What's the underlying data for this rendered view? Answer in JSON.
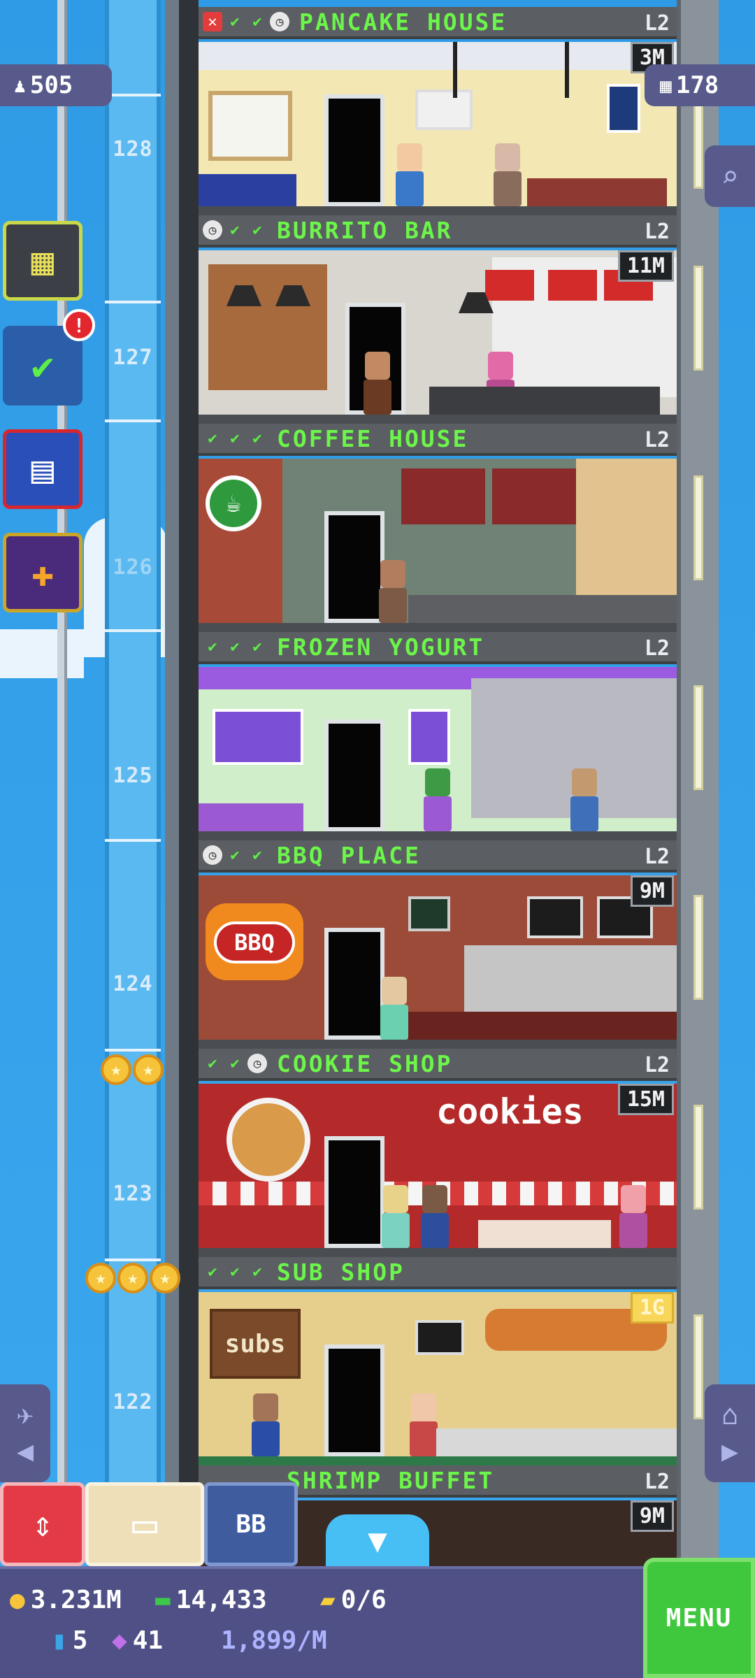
{
  "hud": {
    "population": "505",
    "floor_count": "178"
  },
  "floors": [
    {
      "number": "128",
      "name": "PANCAKE HOUSE",
      "level": "L2",
      "stock": "3M",
      "status": [
        "x",
        "ok",
        "ok",
        "clock"
      ]
    },
    {
      "number": "127",
      "name": "BURRITO BAR",
      "level": "L2",
      "stock": "11M",
      "status": [
        "clock",
        "ok",
        "ok"
      ]
    },
    {
      "number": "126",
      "name": "COFFEE HOUSE",
      "level": "L2",
      "stock": "",
      "status": [
        "ok",
        "ok",
        "ok"
      ]
    },
    {
      "number": "125",
      "name": "FROZEN YOGURT",
      "level": "L2",
      "stock": "",
      "status": [
        "ok",
        "ok",
        "ok"
      ]
    },
    {
      "number": "124",
      "name": "BBQ PLACE",
      "level": "L2",
      "stock": "9M",
      "status": [
        "clock",
        "ok",
        "ok"
      ]
    },
    {
      "number": "123",
      "name": "COOKIE SHOP",
      "level": "L2",
      "stock": "15M",
      "status": [
        "ok",
        "ok",
        "clock"
      ]
    },
    {
      "number": "122",
      "name": "SUB SHOP",
      "level": "",
      "stock": "1G",
      "status": [
        "ok",
        "ok",
        "ok"
      ]
    },
    {
      "number": "",
      "name": "SHRIMP BUFFET",
      "level": "L2",
      "stock": "9M",
      "status": []
    }
  ],
  "signs": {
    "bbq": "BBQ",
    "cookies": "cookies",
    "subs": "subs"
  },
  "notifications": {
    "tasks_alert": "!"
  },
  "toolbar": {
    "bb_label": "BB"
  },
  "status_bar": {
    "coins": "3.231M",
    "bux": "14,433",
    "tickets": "0/6",
    "keys": "5",
    "vip": "41",
    "rate": "1,899/M",
    "menu_label": "MENU"
  },
  "colors": {
    "sky": "#3aa3e8",
    "header_text": "#6cf54a",
    "menu_green": "#3fc73d",
    "hud_purple": "#575a8a"
  }
}
